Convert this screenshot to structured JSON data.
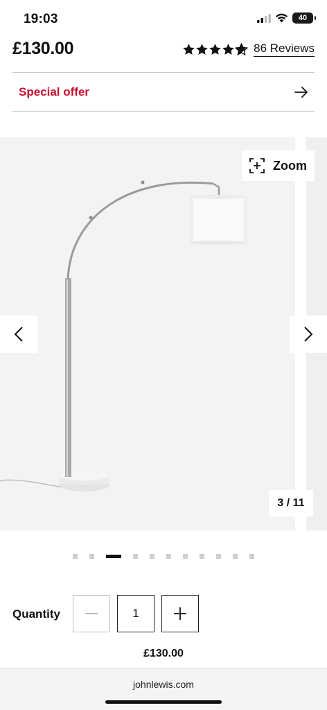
{
  "status_bar": {
    "time": "19:03",
    "battery": "40"
  },
  "product": {
    "price": "£130.00",
    "rating_stars": 4.5,
    "reviews_label": "86 Reviews"
  },
  "offer": {
    "label": "Special offer"
  },
  "gallery": {
    "zoom_label": "Zoom",
    "counter": "3 / 11",
    "total_images": 11,
    "active_dot": 2
  },
  "quantity": {
    "label": "Quantity",
    "value": "1"
  },
  "total_price": "£130.00",
  "browser": {
    "url": "johnlewis.com"
  },
  "colors": {
    "offer_red": "#c8102e",
    "gallery_bg": "#f3f3f3",
    "text": "#111111"
  }
}
